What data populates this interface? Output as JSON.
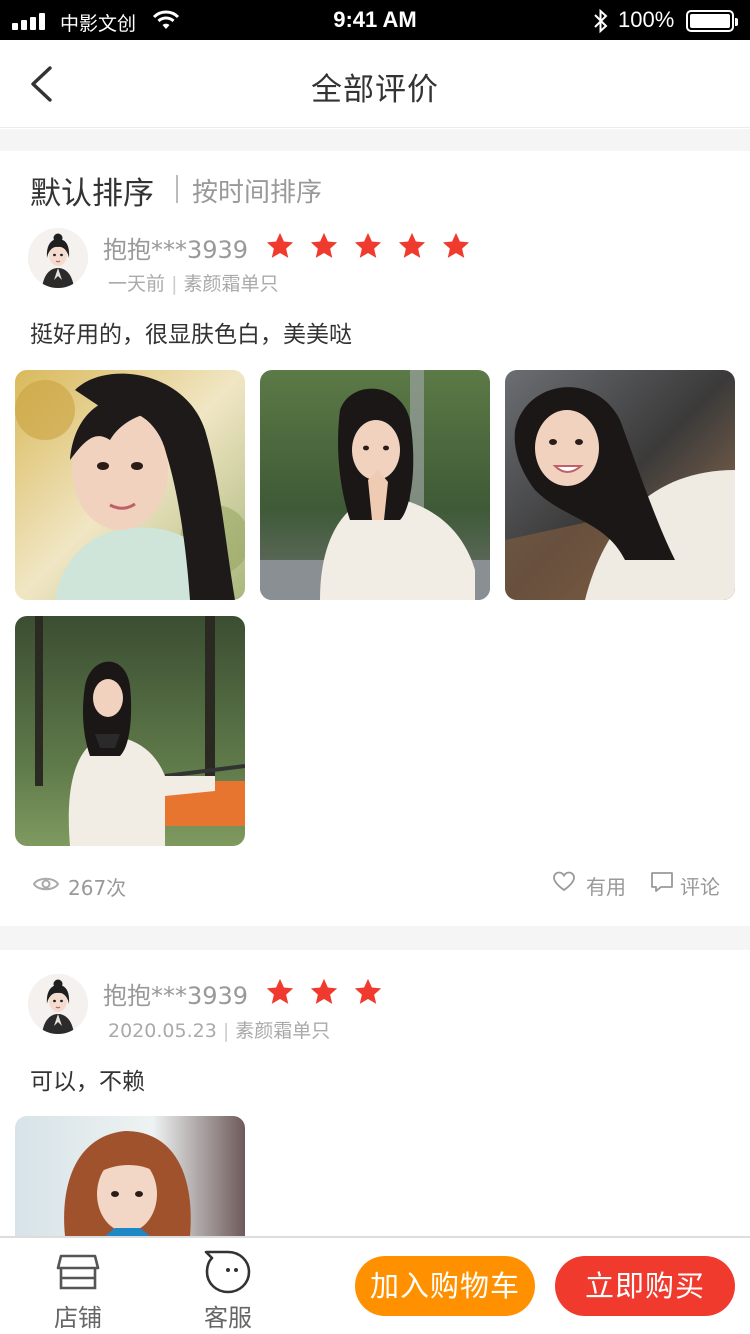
{
  "status_bar": {
    "carrier": "中影文创",
    "time": "9:41 AM",
    "battery": "100%"
  },
  "header": {
    "title": "全部评价"
  },
  "sort": {
    "default_label": "默认排序",
    "time_label": "按时间排序"
  },
  "reviews": [
    {
      "user": "抱抱***3939",
      "rating": 5,
      "date": "一天前",
      "product": "素颜霜单只",
      "text": "挺好用的，很显肤色白，美美哒",
      "photos": 4,
      "views": "267次",
      "useful_label": "有用",
      "comment_label": "评论"
    },
    {
      "user": "抱抱***3939",
      "rating": 3,
      "date": "2020.05.23",
      "product": "素颜霜单只",
      "text": "可以，不赖",
      "photos": 1
    }
  ],
  "bottom_bar": {
    "shop_label": "店铺",
    "service_label": "客服",
    "add_to_cart_label": "加入购物车",
    "buy_now_label": "立即购买"
  },
  "colors": {
    "star": "#f03a2e",
    "cart": "#ff9100",
    "buy": "#f03a2e"
  },
  "icons": [
    "back-arrow-icon",
    "eye-icon",
    "heart-icon",
    "comment-icon",
    "store-icon",
    "chat-bubble-icon",
    "star-icon"
  ]
}
